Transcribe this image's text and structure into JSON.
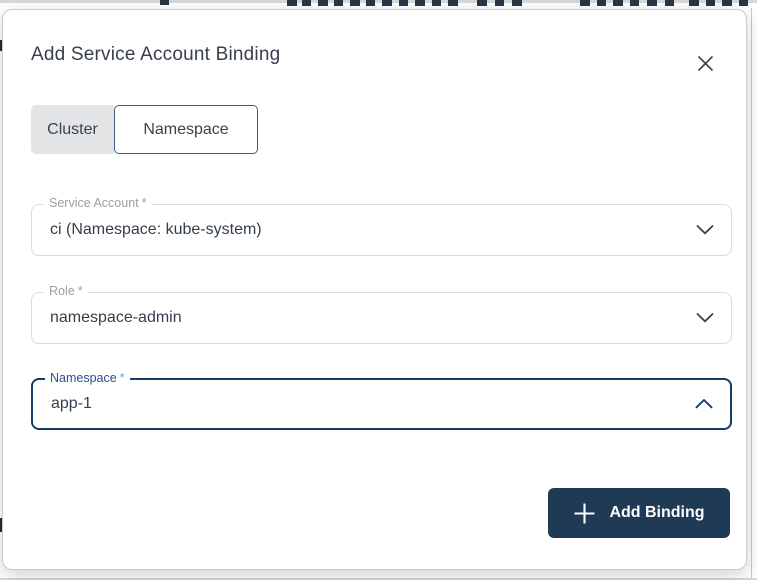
{
  "modal": {
    "title": "Add Service Account Binding",
    "close_icon": "close-x"
  },
  "tabs": [
    {
      "label": "Cluster",
      "selected": false
    },
    {
      "label": "Namespace",
      "selected": true
    }
  ],
  "fields": [
    {
      "label": "Service Account",
      "required": "*",
      "value": "ci (Namespace: kube-system)",
      "state": "collapsed"
    },
    {
      "label": "Role",
      "required": "*",
      "value": "namespace-admin",
      "state": "collapsed"
    },
    {
      "label": "Namespace",
      "required": "*",
      "value": "app-1",
      "state": "expanded"
    }
  ],
  "actions": {
    "add_binding_label": "Add Binding"
  },
  "colors": {
    "primary_navy": "#1e3a55",
    "focus_border": "#173d6b",
    "focus_label": "#2a518e",
    "tab_selected_border": "#3d5e85",
    "tab_unselected_bg": "#e3e4e6",
    "field_border": "#d9dbde",
    "label_gray": "#98a0a8",
    "text_dark": "#353f4b"
  }
}
